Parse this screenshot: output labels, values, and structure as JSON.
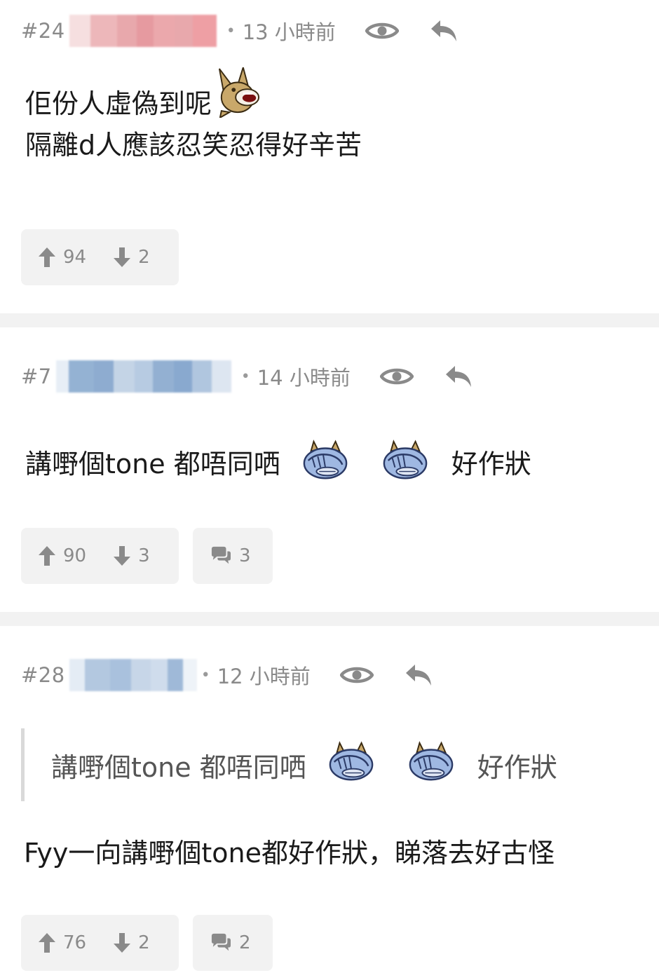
{
  "posts": [
    {
      "floor": "#24",
      "separator": "•",
      "time": "13 小時前",
      "content_lines": [
        "佢份人虛偽到呢",
        "隔離d人應該忍笑忍得好辛苦"
      ],
      "upvotes": "94",
      "downvotes": "2",
      "icons": {
        "view": "eye-icon",
        "reply": "reply-icon",
        "emoji": "screaming-dog-emoji"
      }
    },
    {
      "floor": "#7",
      "separator": "•",
      "time": "14 小時前",
      "content_before": "講嘢個tone 都唔同哂",
      "content_after": "好作狀",
      "upvotes": "90",
      "downvotes": "3",
      "comments": "3",
      "icons": {
        "view": "eye-icon",
        "reply": "reply-icon",
        "emoji": "facepalm-emoji",
        "comments": "speech-bubbles-icon"
      }
    },
    {
      "floor": "#28",
      "separator": "•",
      "time": "12 小時前",
      "quote_before": "講嘢個tone 都唔同哂",
      "quote_after": "好作狀",
      "content": "Fyy一向講嘢個tone都好作狀，睇落去好古怪",
      "upvotes": "76",
      "downvotes": "2",
      "comments": "2",
      "icons": {
        "view": "eye-icon",
        "reply": "reply-icon",
        "emoji": "facepalm-emoji",
        "comments": "speech-bubbles-icon"
      }
    }
  ],
  "colors": {
    "meta_text": "#8a8a8a",
    "content_text": "#1a1a1a",
    "quote_text": "#555555",
    "button_bg": "#f2f2f2",
    "divider": "#f2f2f2",
    "name_blur_pink": "#e8a8ac",
    "name_blur_blue": "#8fb0d3"
  }
}
